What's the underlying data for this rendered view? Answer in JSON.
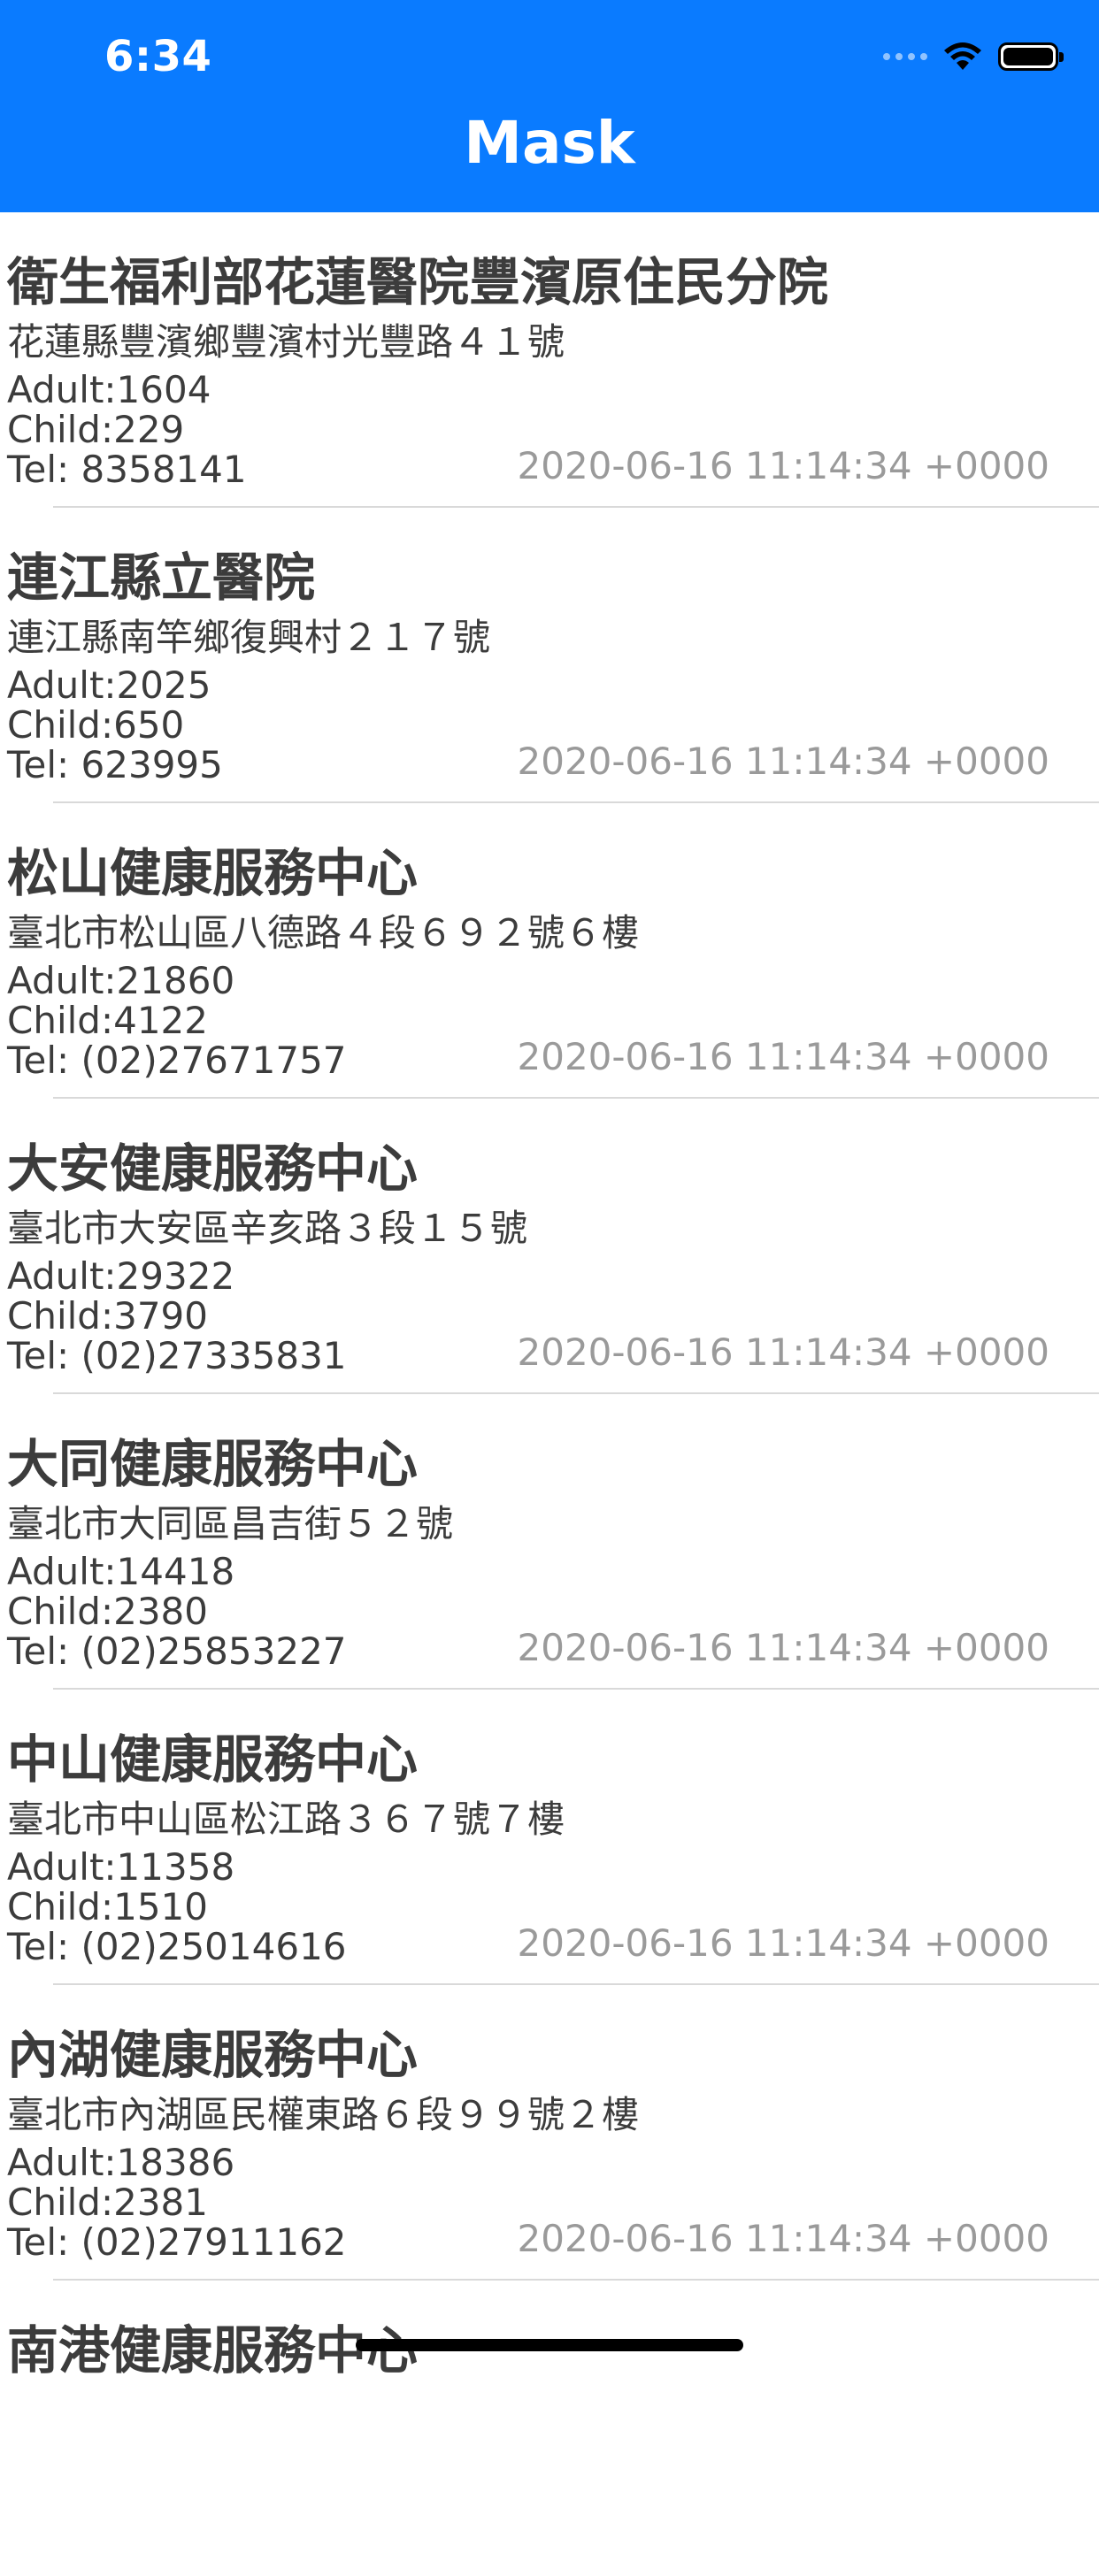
{
  "status_bar": {
    "time": "6:34"
  },
  "nav": {
    "title": "Mask"
  },
  "colors": {
    "header": "#0a7bff",
    "text": "#3c3c3c",
    "timestamp": "#9a9a9a",
    "separator": "#d9d9d9"
  },
  "items": [
    {
      "name": "衛生福利部花蓮醫院豐濱原住民分院",
      "address": "花蓮縣豐濱鄉豐濱村光豐路４１號",
      "adult": "Adult:1604",
      "child": "Child:229",
      "tel": "Tel: 8358141",
      "updated": "2020-06-16 11:14:34 +0000"
    },
    {
      "name": "連江縣立醫院",
      "address": "連江縣南竿鄉復興村２１７號",
      "adult": "Adult:2025",
      "child": "Child:650",
      "tel": "Tel: 623995",
      "updated": "2020-06-16 11:14:34 +0000"
    },
    {
      "name": "松山健康服務中心",
      "address": "臺北市松山區八德路４段６９２號６樓",
      "adult": "Adult:21860",
      "child": "Child:4122",
      "tel": "Tel: (02)27671757",
      "updated": "2020-06-16 11:14:34 +0000"
    },
    {
      "name": "大安健康服務中心",
      "address": "臺北市大安區辛亥路３段１５號",
      "adult": "Adult:29322",
      "child": "Child:3790",
      "tel": "Tel: (02)27335831",
      "updated": "2020-06-16 11:14:34 +0000"
    },
    {
      "name": "大同健康服務中心",
      "address": "臺北市大同區昌吉街５２號",
      "adult": "Adult:14418",
      "child": "Child:2380",
      "tel": "Tel: (02)25853227",
      "updated": "2020-06-16 11:14:34 +0000"
    },
    {
      "name": "中山健康服務中心",
      "address": "臺北市中山區松江路３６７號７樓",
      "adult": "Adult:11358",
      "child": "Child:1510",
      "tel": "Tel: (02)25014616",
      "updated": "2020-06-16 11:14:34 +0000"
    },
    {
      "name": "內湖健康服務中心",
      "address": "臺北市內湖區民權東路６段９９號２樓",
      "adult": "Adult:18386",
      "child": "Child:2381",
      "tel": "Tel: (02)27911162",
      "updated": "2020-06-16 11:14:34 +0000"
    },
    {
      "name": "南港健康服務中心",
      "address": "",
      "adult": "",
      "child": "",
      "tel": "",
      "updated": ""
    }
  ]
}
